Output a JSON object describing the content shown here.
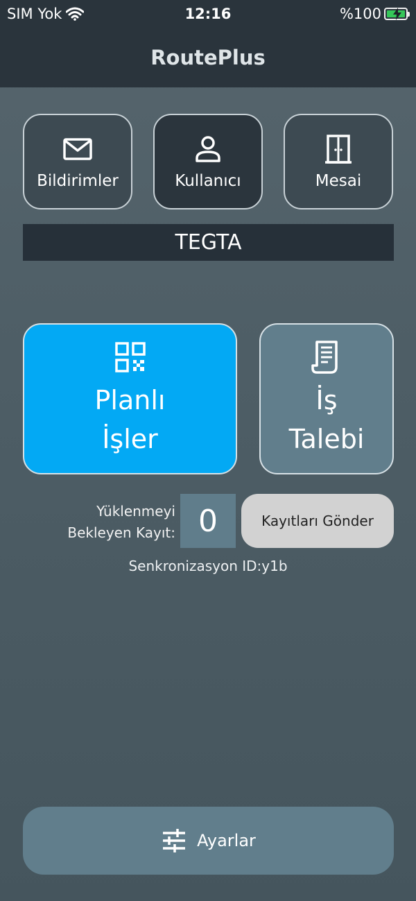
{
  "status_bar": {
    "carrier": "SIM Yok",
    "time": "12:16",
    "battery": "%100",
    "wifi_icon": "wifi-icon",
    "battery_icon": "battery-charging-icon"
  },
  "header": {
    "title": "RoutePlus"
  },
  "top_buttons": [
    {
      "label": "Bildirimler",
      "icon": "mail-icon"
    },
    {
      "label": "Kullanıcı",
      "icon": "user-icon"
    },
    {
      "label": "Mesai",
      "icon": "door-icon"
    }
  ],
  "banner": {
    "text": "TEGTA"
  },
  "main_buttons": {
    "planned": {
      "line1": "Planlı",
      "line2": "İşler",
      "icon": "qr-code-icon",
      "color": "#03A9F4"
    },
    "request": {
      "line1": "İş",
      "line2": "Talebi",
      "icon": "receipt-icon",
      "color": "#617E8C"
    }
  },
  "pending": {
    "label_line1": "Yüklenmeyi",
    "label_line2": "Bekleyen Kayıt:",
    "count": "0",
    "send_label": "Kayıtları Gönder"
  },
  "sync": {
    "text": "Senkronizasyon ID:y1b"
  },
  "settings": {
    "label": "Ayarlar",
    "icon": "sliders-icon"
  }
}
